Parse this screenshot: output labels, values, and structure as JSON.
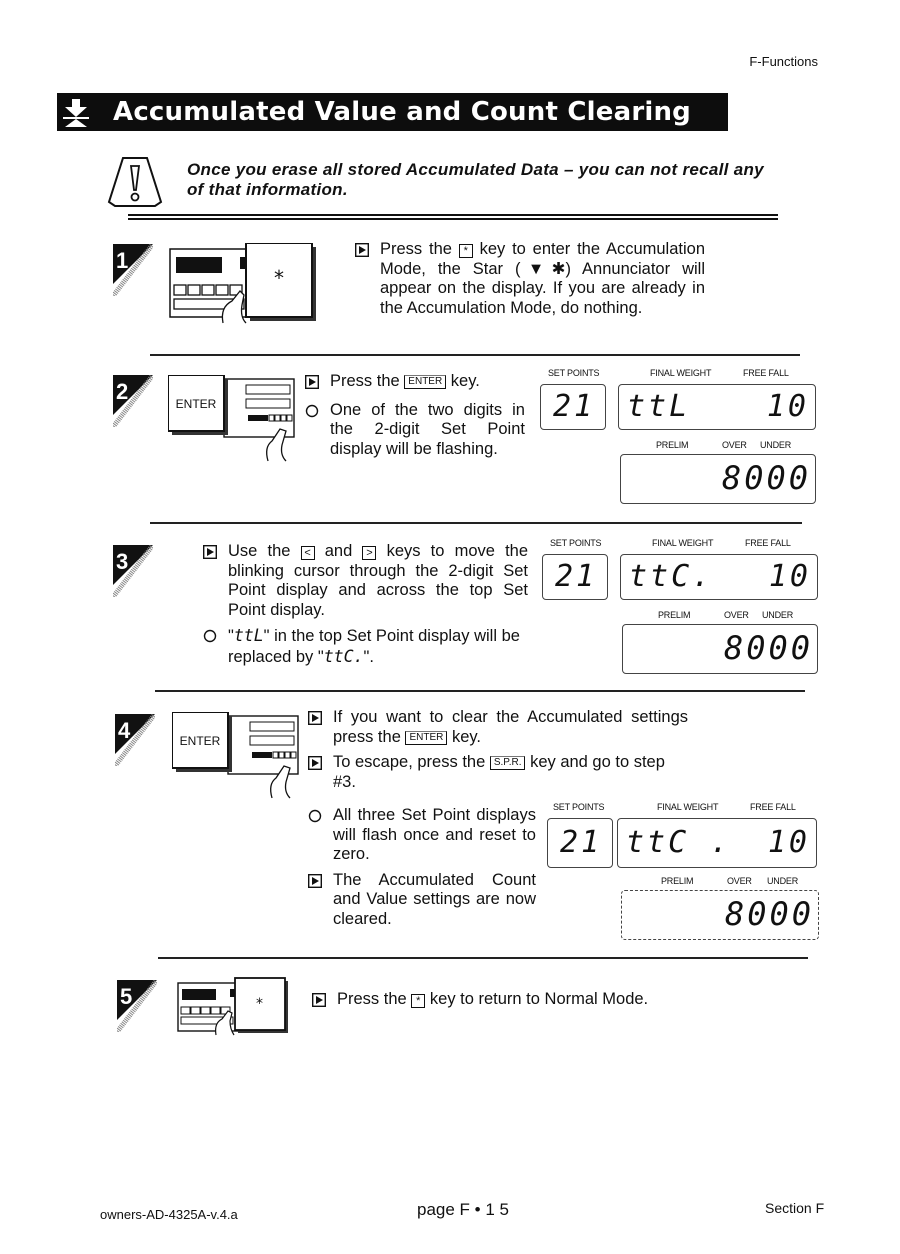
{
  "header": {
    "section_name": "F-Functions"
  },
  "title": {
    "text": "Accumulated Value and Count Clearing",
    "icon": "tare-arrow-icon"
  },
  "warning": {
    "icon": "caution-triangle-icon",
    "text": "Once you erase all stored Accumulated Data – you can not recall any of that information."
  },
  "steps": [
    {
      "number": "1",
      "illustration": {
        "key_label": "*"
      },
      "items": [
        {
          "type": "action",
          "parts": [
            "Press the",
            "*",
            "key to enter the Accumulation Mode, the Star (▼✱) Annunciator will appear on the display. If you are already in the Accumulation Mode, do nothing."
          ]
        }
      ]
    },
    {
      "number": "2",
      "illustration": {
        "key_label": "ENTER"
      },
      "items": [
        {
          "type": "action",
          "parts": [
            "Press the",
            "ENTER",
            "key."
          ]
        },
        {
          "type": "result",
          "text": "One of the two digits in the 2-digit Set Point display will be flashing."
        }
      ],
      "display": {
        "labels": {
          "set_points": "SET POINTS",
          "final_weight": "FINAL WEIGHT",
          "free_fall": "FREE FALL",
          "prelim": "PRELIM",
          "over": "OVER",
          "under": "UNDER"
        },
        "set_point_value": "21",
        "final_weight_value": "ttL",
        "free_fall_value": "10",
        "prelim_value": "8000"
      }
    },
    {
      "number": "3",
      "items": [
        {
          "type": "action",
          "parts": [
            "Use the",
            "<",
            "and",
            ">",
            "keys to move the blinking cursor through the 2-digit Set Point display and across the top Set Point display."
          ]
        },
        {
          "type": "result",
          "parts": [
            "\"",
            "ttL",
            "\" in the top Set Point display will be replaced by \"",
            "ttC.",
            "\"."
          ]
        }
      ],
      "display": {
        "labels": {
          "set_points": "SET POINTS",
          "final_weight": "FINAL WEIGHT",
          "free_fall": "FREE FALL",
          "prelim": "PRELIM",
          "over": "OVER",
          "under": "UNDER"
        },
        "set_point_value": "21",
        "final_weight_value": "ttC.",
        "free_fall_value": "10",
        "prelim_value": "8000"
      }
    },
    {
      "number": "4",
      "illustration": {
        "key_label": "ENTER"
      },
      "items": [
        {
          "type": "action",
          "parts": [
            "If you want to clear the Accumulated settings press the",
            "ENTER",
            "key."
          ]
        },
        {
          "type": "action",
          "parts": [
            "To escape, press the",
            "S.P.R.",
            "key and go to step #3."
          ]
        },
        {
          "type": "result",
          "text": "All three Set Point displays will flash once and reset to zero."
        },
        {
          "type": "action",
          "text": "The Accumulated Count and Value settings are now cleared."
        }
      ],
      "display": {
        "labels": {
          "set_points": "SET POINTS",
          "final_weight": "FINAL WEIGHT",
          "free_fall": "FREE FALL",
          "prelim": "PRELIM",
          "over": "OVER",
          "under": "UNDER"
        },
        "set_point_value": "21",
        "final_weight_value": "ttC .",
        "free_fall_value": "10",
        "prelim_value": "8000"
      }
    },
    {
      "number": "5",
      "illustration": {
        "key_label": "*"
      },
      "items": [
        {
          "type": "action",
          "parts": [
            "Press the",
            "*",
            "key to return to Normal Mode."
          ]
        }
      ]
    }
  ],
  "footer": {
    "doc_id": "owners-AD-4325A-v.4.a",
    "page": "page F • 1 5",
    "section": "Section F"
  }
}
